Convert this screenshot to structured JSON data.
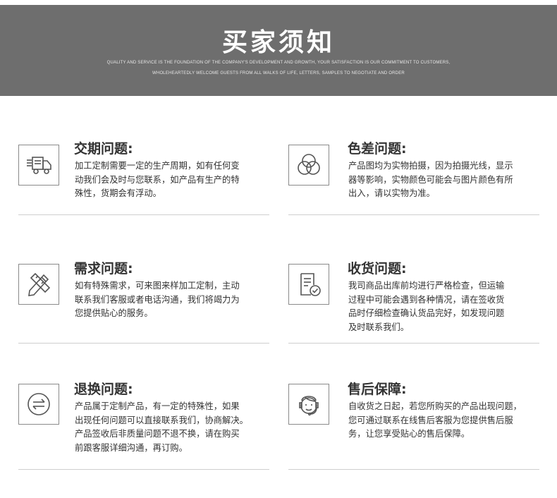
{
  "banner": {
    "title": "买家须知",
    "subtitle_line1": "QUALITY AND SERVICE IS THE FOUNDATION OF THE COMPANY'S DEVELOPMENT AND GROWTH, YOUR SATISFACTION IS OUR COMMITMENT TO CUSTOMERS,",
    "subtitle_line2": "WHOLEHEARTEDLY WELCOME GUESTS FROM ALL WALKS OF LIFE, LETTERS, SAMPLES TO NEGOTIATE AND ORDER"
  },
  "items": [
    {
      "icon": "delivery-truck-icon",
      "title": "交期问题:",
      "text": "加工定制需要一定的生产周期，如有任何变\n动我们会及时与您联系，如产品有生产的特\n殊性，货期会有浮动。"
    },
    {
      "icon": "color-circles-icon",
      "title": "色差问题:",
      "text": "产品图均为实物拍摄，因为拍摄光线，显示\n器等影响，实物颜色可能会与图片颜色有所\n出入，请以实物为准。"
    },
    {
      "icon": "pencil-ruler-icon",
      "title": "需求问题:",
      "text": "如有特殊需求，可来图来样加工定制，主动\n联系我们客服或者电话沟通，我们将竭力为\n您提供贴心的服务。"
    },
    {
      "icon": "receipt-check-icon",
      "title": "收货问题:",
      "text": "我司商品出库前均进行严格检查，但运输\n过程中可能会遇到各种情况，请在签收货\n品时仔细检查确认货品完好，如发现问题\n及时联系我们。"
    },
    {
      "icon": "exchange-arrows-icon",
      "title": "退换问题:",
      "text": "产品属于定制产品，有一定的特殊性，如果\n出现任何问题可以直接联系我们，协商解决。\n产品签收后非质量问题不退不换，请在购买\n前跟客服详细沟通，再订购。"
    },
    {
      "icon": "customer-service-icon",
      "title": "售后保障:",
      "text": "自收货之日起，若您所购买的产品出现问题，\n您可通过联系在线售后客服为您提供售后服\n务，让您享受贴心的售后保障。"
    }
  ]
}
